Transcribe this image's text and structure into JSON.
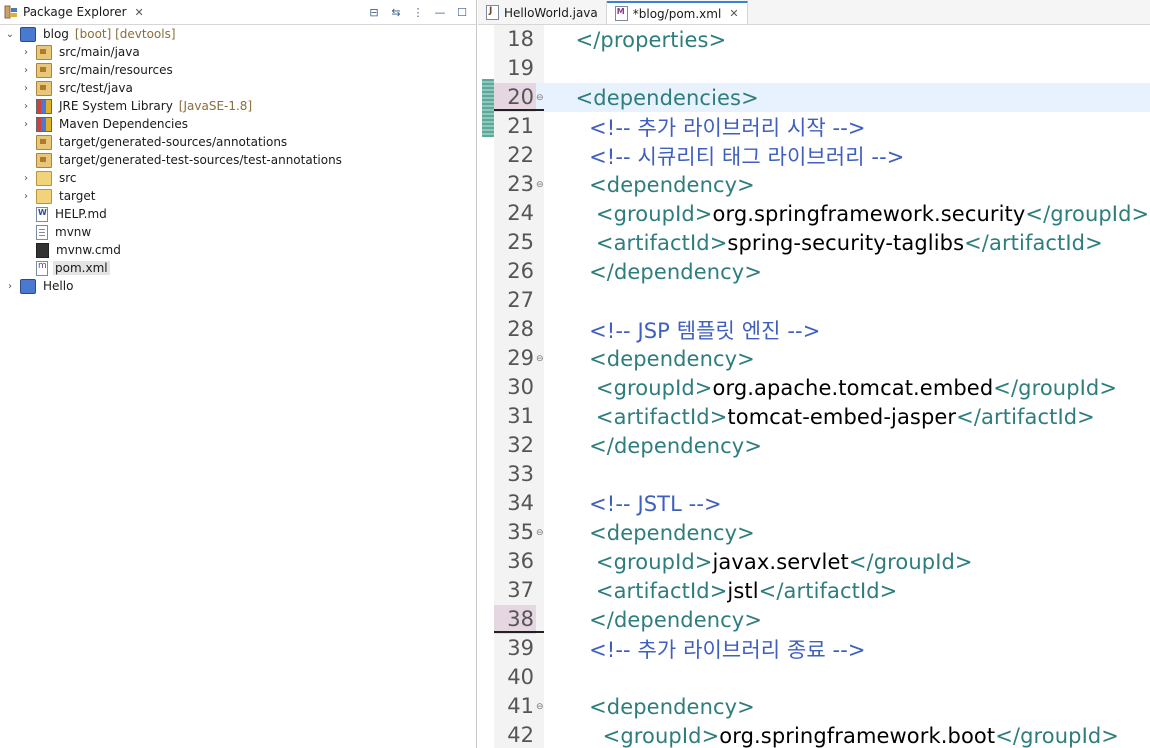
{
  "explorer": {
    "title": "Package Explorer",
    "close": "✕",
    "toolbar": {
      "collapse_all": "⊟",
      "link_editor": "⇆",
      "view_menu": "⋮",
      "minimize": "—",
      "maximize": "☐"
    },
    "items": [
      {
        "label": "blog",
        "decoration": "[boot] [devtools]",
        "expanded": true,
        "icon": "project-icon"
      },
      {
        "label": "src/main/java",
        "icon": "source-folder-icon"
      },
      {
        "label": "src/main/resources",
        "icon": "source-folder-icon"
      },
      {
        "label": "src/test/java",
        "icon": "source-folder-icon"
      },
      {
        "label": "JRE System Library",
        "decoration": "[JavaSE-1.8]",
        "icon": "library-icon"
      },
      {
        "label": "Maven Dependencies",
        "icon": "library-icon"
      },
      {
        "label": "target/generated-sources/annotations",
        "icon": "source-folder-icon"
      },
      {
        "label": "target/generated-test-sources/test-annotations",
        "icon": "source-folder-icon"
      },
      {
        "label": "src",
        "icon": "folder-icon"
      },
      {
        "label": "target",
        "icon": "folder-icon"
      },
      {
        "label": "HELP.md",
        "icon": "markdown-file-icon"
      },
      {
        "label": "mvnw",
        "icon": "file-icon"
      },
      {
        "label": "mvnw.cmd",
        "icon": "cmd-file-icon"
      },
      {
        "label": "pom.xml",
        "icon": "xml-file-icon",
        "selected": true
      },
      {
        "label": "Hello",
        "icon": "project-icon"
      }
    ]
  },
  "editor": {
    "tabs": [
      {
        "label": "HelloWorld.java",
        "icon": "java-file-icon",
        "active": false
      },
      {
        "label": "*blog/pom.xml",
        "icon": "maven-file-icon",
        "active": true
      }
    ],
    "close": "✕",
    "fold_marker": "⊖",
    "lines": [
      {
        "num": "18",
        "parts": [
          {
            "t": "  ",
            "c": "txt"
          },
          {
            "t": "</properties>",
            "c": "tag"
          }
        ]
      },
      {
        "num": "19",
        "parts": []
      },
      {
        "num": "20",
        "fold": true,
        "current": true,
        "marked": true,
        "parts": [
          {
            "t": "  ",
            "c": "txt"
          },
          {
            "t": "<dependencies>",
            "c": "tag"
          }
        ]
      },
      {
        "num": "21",
        "parts": [
          {
            "t": "    ",
            "c": "txt"
          },
          {
            "t": "<!-- 추가 라이브러리 시작 -->",
            "c": "cmt"
          }
        ]
      },
      {
        "num": "22",
        "parts": [
          {
            "t": "    ",
            "c": "txt"
          },
          {
            "t": "<!-- 시큐리티 태그 라이브러리 -->",
            "c": "cmt"
          }
        ]
      },
      {
        "num": "23",
        "fold": true,
        "parts": [
          {
            "t": "    ",
            "c": "txt"
          },
          {
            "t": "<dependency>",
            "c": "tag"
          }
        ]
      },
      {
        "num": "24",
        "parts": [
          {
            "t": "     ",
            "c": "txt"
          },
          {
            "t": "<groupId>",
            "c": "tag"
          },
          {
            "t": "org.springframework.security",
            "c": "txt"
          },
          {
            "t": "</groupId>",
            "c": "tag"
          }
        ]
      },
      {
        "num": "25",
        "parts": [
          {
            "t": "     ",
            "c": "txt"
          },
          {
            "t": "<artifactId>",
            "c": "tag"
          },
          {
            "t": "spring-security-taglibs",
            "c": "txt"
          },
          {
            "t": "</artifactId>",
            "c": "tag"
          }
        ]
      },
      {
        "num": "26",
        "parts": [
          {
            "t": "    ",
            "c": "txt"
          },
          {
            "t": "</dependency>",
            "c": "tag"
          }
        ]
      },
      {
        "num": "27",
        "parts": []
      },
      {
        "num": "28",
        "parts": [
          {
            "t": "    ",
            "c": "txt"
          },
          {
            "t": "<!-- JSP 템플릿 엔진 -->",
            "c": "cmt"
          }
        ]
      },
      {
        "num": "29",
        "fold": true,
        "parts": [
          {
            "t": "    ",
            "c": "txt"
          },
          {
            "t": "<dependency>",
            "c": "tag"
          }
        ]
      },
      {
        "num": "30",
        "parts": [
          {
            "t": "     ",
            "c": "txt"
          },
          {
            "t": "<groupId>",
            "c": "tag"
          },
          {
            "t": "org.apache.tomcat.embed",
            "c": "txt"
          },
          {
            "t": "</groupId>",
            "c": "tag"
          }
        ]
      },
      {
        "num": "31",
        "parts": [
          {
            "t": "     ",
            "c": "txt"
          },
          {
            "t": "<artifactId>",
            "c": "tag"
          },
          {
            "t": "tomcat-embed-jasper",
            "c": "txt"
          },
          {
            "t": "</artifactId>",
            "c": "tag"
          }
        ]
      },
      {
        "num": "32",
        "parts": [
          {
            "t": "    ",
            "c": "txt"
          },
          {
            "t": "</dependency>",
            "c": "tag"
          }
        ]
      },
      {
        "num": "33",
        "parts": []
      },
      {
        "num": "34",
        "parts": [
          {
            "t": "    ",
            "c": "txt"
          },
          {
            "t": "<!-- JSTL -->",
            "c": "cmt"
          }
        ]
      },
      {
        "num": "35",
        "fold": true,
        "parts": [
          {
            "t": "    ",
            "c": "txt"
          },
          {
            "t": "<dependency>",
            "c": "tag"
          }
        ]
      },
      {
        "num": "36",
        "parts": [
          {
            "t": "     ",
            "c": "txt"
          },
          {
            "t": "<groupId>",
            "c": "tag"
          },
          {
            "t": "javax.servlet",
            "c": "txt"
          },
          {
            "t": "</groupId>",
            "c": "tag"
          }
        ]
      },
      {
        "num": "37",
        "parts": [
          {
            "t": "     ",
            "c": "txt"
          },
          {
            "t": "<artifactId>",
            "c": "tag"
          },
          {
            "t": "jstl",
            "c": "txt"
          },
          {
            "t": "</artifactId>",
            "c": "tag"
          }
        ]
      },
      {
        "num": "38",
        "marked": true,
        "parts": [
          {
            "t": "    ",
            "c": "txt"
          },
          {
            "t": "</dependency>",
            "c": "tag"
          }
        ]
      },
      {
        "num": "39",
        "parts": [
          {
            "t": "    ",
            "c": "txt"
          },
          {
            "t": "<!-- 추가 라이브러리 종료 -->",
            "c": "cmt"
          }
        ]
      },
      {
        "num": "40",
        "parts": []
      },
      {
        "num": "41",
        "fold": true,
        "parts": [
          {
            "t": "    ",
            "c": "txt"
          },
          {
            "t": "<dependency>",
            "c": "tag"
          }
        ]
      },
      {
        "num": "42",
        "parts": [
          {
            "t": "      ",
            "c": "txt"
          },
          {
            "t": "<groupId>",
            "c": "tag"
          },
          {
            "t": "org.springframework.boot",
            "c": "txt"
          },
          {
            "t": "</groupId>",
            "c": "tag"
          }
        ]
      }
    ]
  },
  "colors": {
    "tag": "#2e7d7d",
    "comment": "#3f5fbf",
    "text": "#000000",
    "current_line": "#e8f2fe"
  }
}
